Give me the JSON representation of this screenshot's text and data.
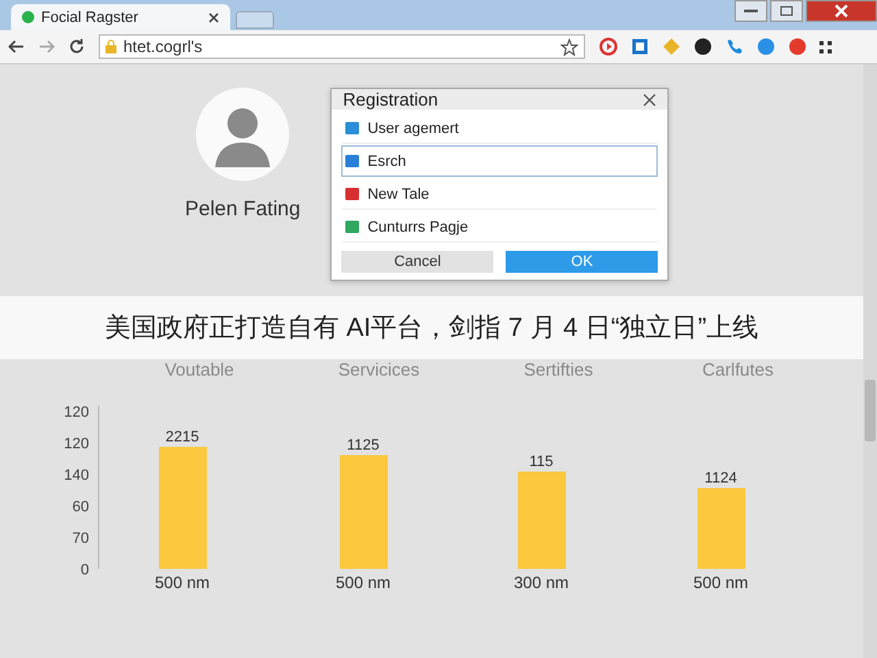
{
  "browser": {
    "tab": {
      "title": "Focial Ragster"
    },
    "address": "htet.cogrl's"
  },
  "profile": {
    "name": "Pelen Fating"
  },
  "dialog": {
    "title": "Registration",
    "items": [
      {
        "label": "User agemert",
        "color": "#2a8fd8",
        "selected": false
      },
      {
        "label": "Esrch",
        "color": "#2a7fd8",
        "selected": true
      },
      {
        "label": "New Tale",
        "color": "#d83030",
        "selected": false
      },
      {
        "label": "Cunturrs Pagje",
        "color": "#30a860",
        "selected": false
      }
    ],
    "buttons": [
      {
        "label": "Cancel",
        "kind": "secondary"
      },
      {
        "label": "OK",
        "kind": "primary"
      }
    ]
  },
  "caption": "美国政府正打造自有 AI平台，剑指 7 月 4 日“独立日”上线",
  "chart": {
    "legend": [
      "Voutable",
      "Servicices",
      "Sertifties",
      "Carlfutes"
    ],
    "bars": [
      {
        "value_label": "2215",
        "category": "500 nm"
      },
      {
        "value_label": "1125",
        "category": "500 nm"
      },
      {
        "value_label": "115",
        "category": "300 nm"
      },
      {
        "value_label": "1124",
        "category": "500 nm"
      }
    ],
    "y_axis_labels": [
      "120",
      "120",
      "140",
      "60",
      "70",
      "0"
    ]
  }
}
